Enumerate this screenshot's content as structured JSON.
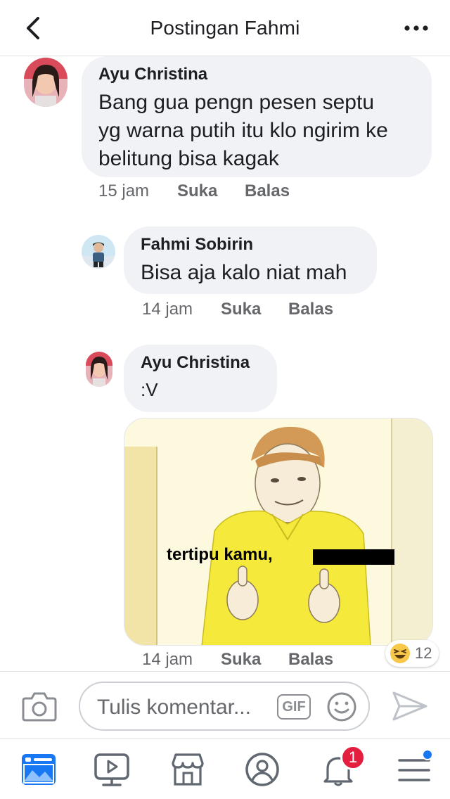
{
  "header": {
    "title": "Postingan Fahmi",
    "back_icon": "chevron-left-icon",
    "more_icon": "more-horizontal-icon"
  },
  "comments": [
    {
      "author": "Ayu Christina",
      "lines": [
        "Bang gua pengn pesen septu",
        "yg warna putih itu klo ngirim ke",
        "belitung bisa kagak"
      ],
      "time": "15 jam",
      "like": "Suka",
      "reply": "Balas"
    },
    {
      "author": "Fahmi Sobirin",
      "lines": [
        "Bisa aja kalo niat mah"
      ],
      "time": "14 jam",
      "like": "Suka",
      "reply": "Balas"
    },
    {
      "author": "Ayu Christina",
      "lines": [
        ":V"
      ],
      "time": "14 jam",
      "like": "Suka",
      "reply": "Balas",
      "image_caption": "tertipu kamu,",
      "reaction_count": "12",
      "reaction_icon": "laughing-emoji-icon"
    }
  ],
  "composer": {
    "placeholder": "Tulis komentar...",
    "gif_label": "GIF"
  },
  "nav": {
    "notification_count": "1",
    "icons": [
      "news-feed-icon",
      "watch-icon",
      "marketplace-icon",
      "profile-icon",
      "bell-icon",
      "menu-icon"
    ]
  },
  "colors": {
    "bubble": "#f0f2f5",
    "accent": "#1877f2",
    "badge": "#e41e3f",
    "meme_shirt": "#f5ea3c"
  }
}
